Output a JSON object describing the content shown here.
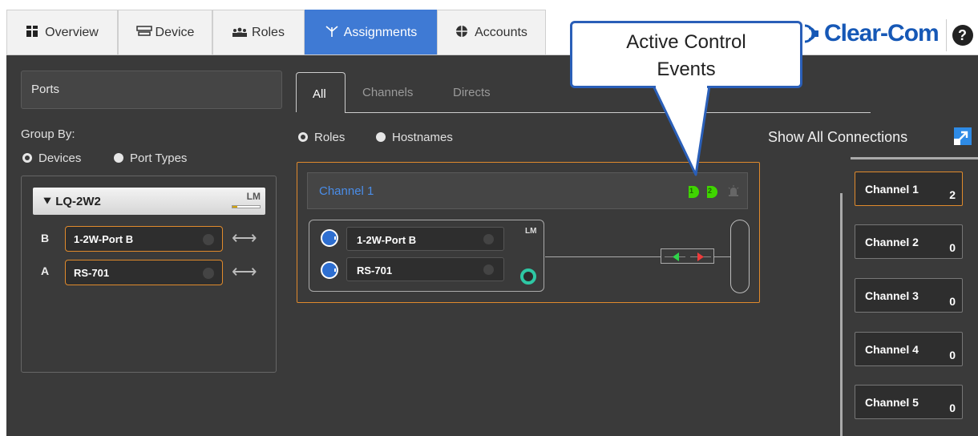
{
  "nav": {
    "tabs": [
      {
        "label": "Overview",
        "icon": "grid-icon"
      },
      {
        "label": "Device",
        "icon": "device-icon"
      },
      {
        "label": "Roles",
        "icon": "roles-icon"
      },
      {
        "label": "Assignments",
        "icon": "assignments-icon",
        "active": true
      },
      {
        "label": "Accounts",
        "icon": "accounts-icon"
      }
    ],
    "logo_text": "Clear-Com",
    "help_label": "?"
  },
  "left": {
    "ports_title": "Ports",
    "group_by_label": "Group By:",
    "group_by_options": [
      "Devices",
      "Port Types"
    ],
    "group_by_selected": "Devices",
    "device": {
      "name": "LQ-2W2",
      "badge": "LM",
      "ports": [
        {
          "letter": "B",
          "name": "1-2W-Port B"
        },
        {
          "letter": "A",
          "name": "RS-701"
        }
      ]
    }
  },
  "center": {
    "tabs": [
      "All",
      "Channels",
      "Directs"
    ],
    "active_tab": "All",
    "view_options": [
      "Roles",
      "Hostnames"
    ],
    "view_selected": "Roles",
    "channel": {
      "name": "Channel 1",
      "events": [
        "1",
        "2"
      ],
      "group_badge": "LM",
      "members": [
        "1-2W-Port B",
        "RS-701"
      ]
    }
  },
  "right": {
    "show_all_label": "Show All Connections",
    "channels": [
      {
        "name": "Channel 1",
        "count": "2"
      },
      {
        "name": "Channel 2",
        "count": "0"
      },
      {
        "name": "Channel 3",
        "count": "0"
      },
      {
        "name": "Channel 4",
        "count": "0"
      },
      {
        "name": "Channel 5",
        "count": "0"
      }
    ]
  },
  "callout": {
    "line1": "Active Control",
    "line2": "Events"
  },
  "colors": {
    "accent": "#3f7ad4",
    "selection_border": "#e08a2c",
    "event_green": "#3fd400",
    "brand": "#1658b6"
  }
}
